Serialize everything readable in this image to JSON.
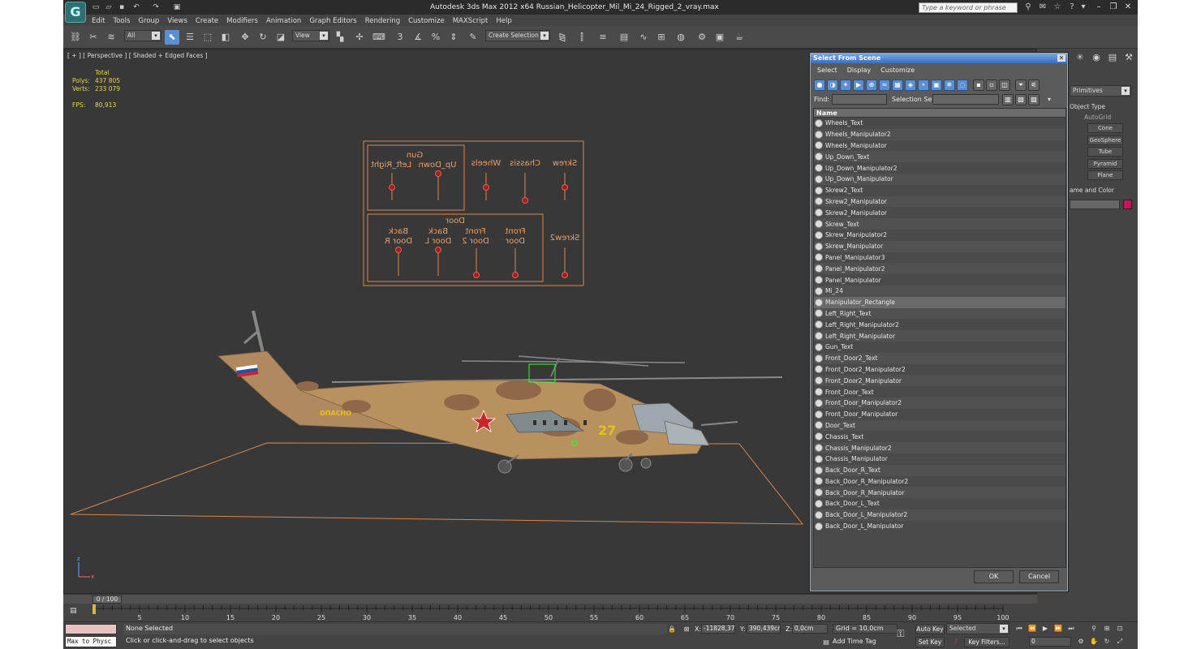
{
  "window": {
    "title": "Autodesk 3ds Max  2012 x64     Russian_Helicopter_Mil_Mi_24_Rigged_2_vray.max",
    "search_placeholder": "Type a keyword or phrase",
    "logo_letter": "G"
  },
  "menu": [
    "Edit",
    "Tools",
    "Group",
    "Views",
    "Create",
    "Modifiers",
    "Animation",
    "Graph Editors",
    "Rendering",
    "Customize",
    "MAXScript",
    "Help"
  ],
  "toolbar": {
    "filter_value": "All",
    "refcoord_value": "View",
    "named_selection_placeholder": "Create Selection Se",
    "snap_label_1": "3",
    "snap_label_2": "%"
  },
  "viewport": {
    "label": "[ + ] [ Perspective ] [ Shaded + Edged Faces ]",
    "stats": {
      "header": "Total",
      "polys_label": "Polys:",
      "polys_value": "437 805",
      "verts_label": "Verts:",
      "verts_value": "233 079",
      "fps_label": "FPS:",
      "fps_value": "80,913"
    },
    "panel_labels": {
      "gun_title": "Gun",
      "up_down": "Up_Down",
      "left_right": "Left_Right",
      "wheels": "Wheels",
      "chassis": "Chassis",
      "skrew": "Skrew",
      "door_title": "Door",
      "front_door": "Front",
      "front_door_2": "Door",
      "front_door2": "Front",
      "front_door2_2": "Door 2",
      "back_door_l": "Back",
      "back_door_l_2": "Door L",
      "back_door_r": "Back",
      "back_door_r_2": "Door R",
      "skrew2": "Skrew2"
    },
    "heli_text": {
      "number": "27",
      "side_text": "ОПАСНО"
    }
  },
  "command_panel": {
    "dropdown": "Primitives",
    "object_type": "Object Type",
    "autogrid": "AutoGrid",
    "buttons": [
      "Cone",
      "GeoSphere",
      "Tube",
      "Pyramid",
      "Plane"
    ],
    "name_and_color": "ame and Color",
    "color": "#c2185b"
  },
  "dialog": {
    "title": "Select From Scene",
    "menu": [
      "Select",
      "Display",
      "Customize"
    ],
    "find_label": "Find:",
    "selection_set_label": "Selection Set:",
    "column_header": "Name",
    "selected_index": 16,
    "items": [
      "Wheels_Text",
      "Wheels_Manipulator2",
      "Wheels_Manipulator",
      "Up_Down_Text",
      "Up_Down_Manipulator2",
      "Up_Down_Manipulator",
      "Skrew2_Text",
      "Skrew2_Manipulator",
      "Skrew2_Manipulator",
      "Skrew_Text",
      "Skrew_Manipulator2",
      "Skrew_Manipulator",
      "Panel_Manipulator3",
      "Panel_Manipulator2",
      "Panel_Manipulator",
      "Mi_24",
      "Manipulator_Rectangle",
      "Left_Right_Text",
      "Left_Right_Manipulator2",
      "Left_Right_Manipulator",
      "Gun_Text",
      "Front_Door2_Text",
      "Front_Door2_Manipulator2",
      "Front_Door2_Manipulator",
      "Front_Door_Text",
      "Front_Door_Manipulator2",
      "Front_Door_Manipulator",
      "Door_Text",
      "Chassis_Text",
      "Chassis_Manipulator2",
      "Chassis_Manipulator",
      "Back_Door_R_Text",
      "Back_Door_R_Manipulator2",
      "Back_Door_R_Manipulator",
      "Back_Door_L_Text",
      "Back_Door_L_Manipulator2",
      "Back_Door_L_Manipulator"
    ],
    "ok_label": "OK",
    "cancel_label": "Cancel"
  },
  "timeline": {
    "thumb": "0 / 100",
    "ticks": [
      "5",
      "10",
      "15",
      "20",
      "25",
      "30",
      "35",
      "40",
      "45",
      "50",
      "55",
      "60",
      "65",
      "70",
      "75",
      "80",
      "85",
      "90",
      "95",
      "100"
    ]
  },
  "status": {
    "listener": "Max to Physc",
    "selection": "None Selected",
    "prompt": "Click or click-and-drag to select objects",
    "x_label": "X:",
    "x_value": "-11828,375",
    "y_label": "Y:",
    "y_value": "390,439cm",
    "z_label": "Z:",
    "z_value": "0,0cm",
    "grid": "Grid = 10,0cm",
    "add_time_tag": "Add Time Tag",
    "auto_key": "Auto Key",
    "set_key": "Set Key",
    "key_mode": "Selected",
    "key_filters": "Key Filters...",
    "frame": "0"
  }
}
